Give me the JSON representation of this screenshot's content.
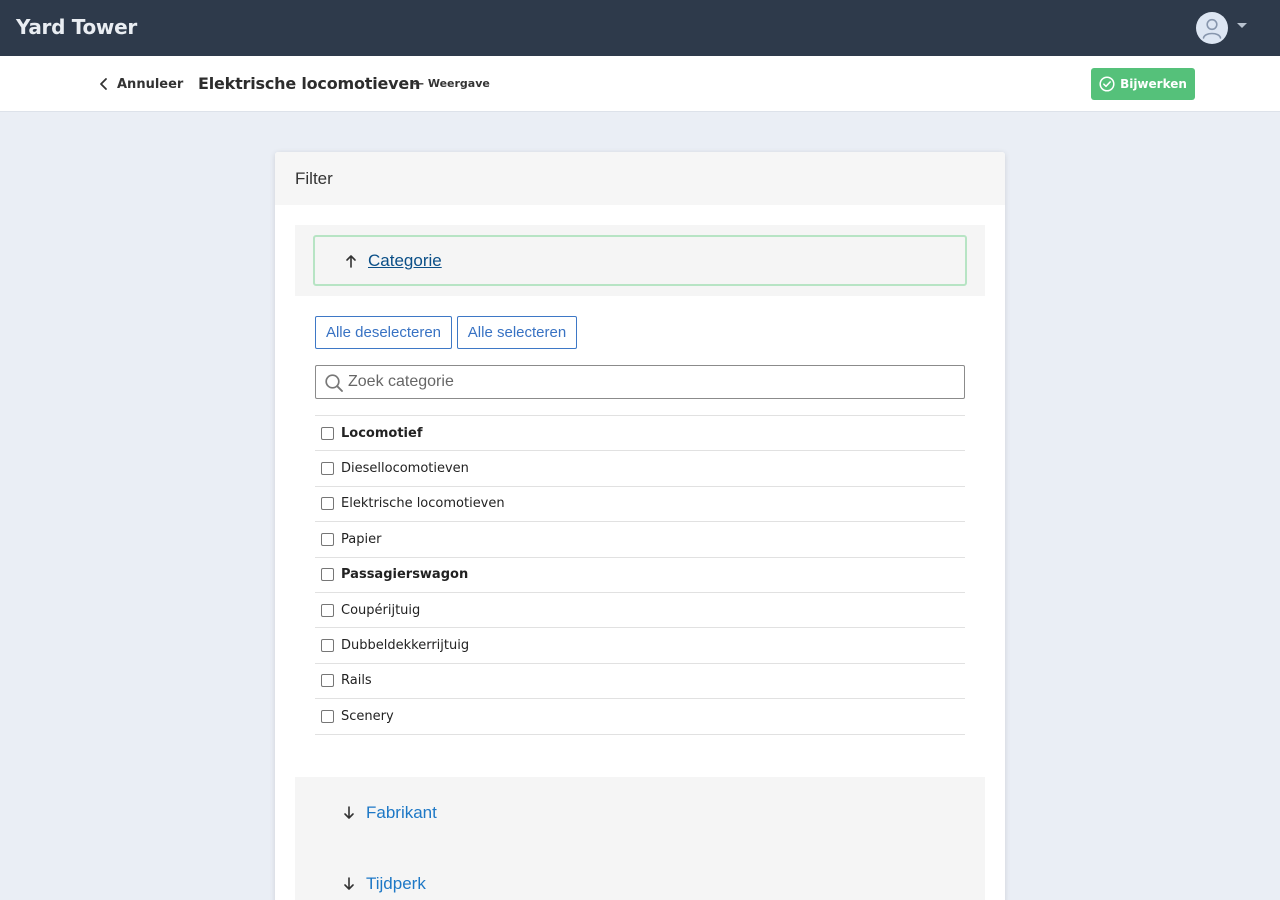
{
  "app": {
    "brand": "Yard Tower"
  },
  "header": {
    "cancel_label": "Annuleer",
    "title": "Elektrische locomotieven",
    "subtitle": "— Weergave",
    "update_label": "Bijwerken"
  },
  "filter": {
    "title": "Filter",
    "category_section": {
      "label": "Categorie",
      "expanded": true,
      "deselect_all_label": "Alle deselecteren",
      "select_all_label": "Alle selecteren",
      "search_placeholder": "Zoek categorie",
      "search_value": "",
      "items": [
        {
          "label": "Locomotief",
          "bold": true,
          "checked": false
        },
        {
          "label": "Diesellocomotieven",
          "bold": false,
          "checked": false
        },
        {
          "label": "Elektrische locomotieven",
          "bold": false,
          "checked": false
        },
        {
          "label": "Papier",
          "bold": false,
          "checked": false
        },
        {
          "label": "Passagierswagon",
          "bold": true,
          "checked": false
        },
        {
          "label": "Coupérijtuig",
          "bold": false,
          "checked": false
        },
        {
          "label": "Dubbeldekkerrijtuig",
          "bold": false,
          "checked": false
        },
        {
          "label": "Rails",
          "bold": false,
          "checked": false
        },
        {
          "label": "Scenery",
          "bold": false,
          "checked": false
        }
      ]
    },
    "collapsed_sections": [
      {
        "label": "Fabrikant",
        "expanded": false
      },
      {
        "label": "Tijdperk",
        "expanded": false
      }
    ]
  },
  "colors": {
    "topbar": "#2e3a4b",
    "accent_green": "#55c17a",
    "link_blue": "#1d78c6",
    "outline_blue": "#3e78c6"
  },
  "icons": {
    "user": "user-icon",
    "dropdown": "caret-down-icon",
    "back": "chevron-left-icon",
    "update": "check-circle-icon",
    "expanded": "arrow-up-icon",
    "collapsed": "arrow-down-icon",
    "search": "search-icon"
  }
}
